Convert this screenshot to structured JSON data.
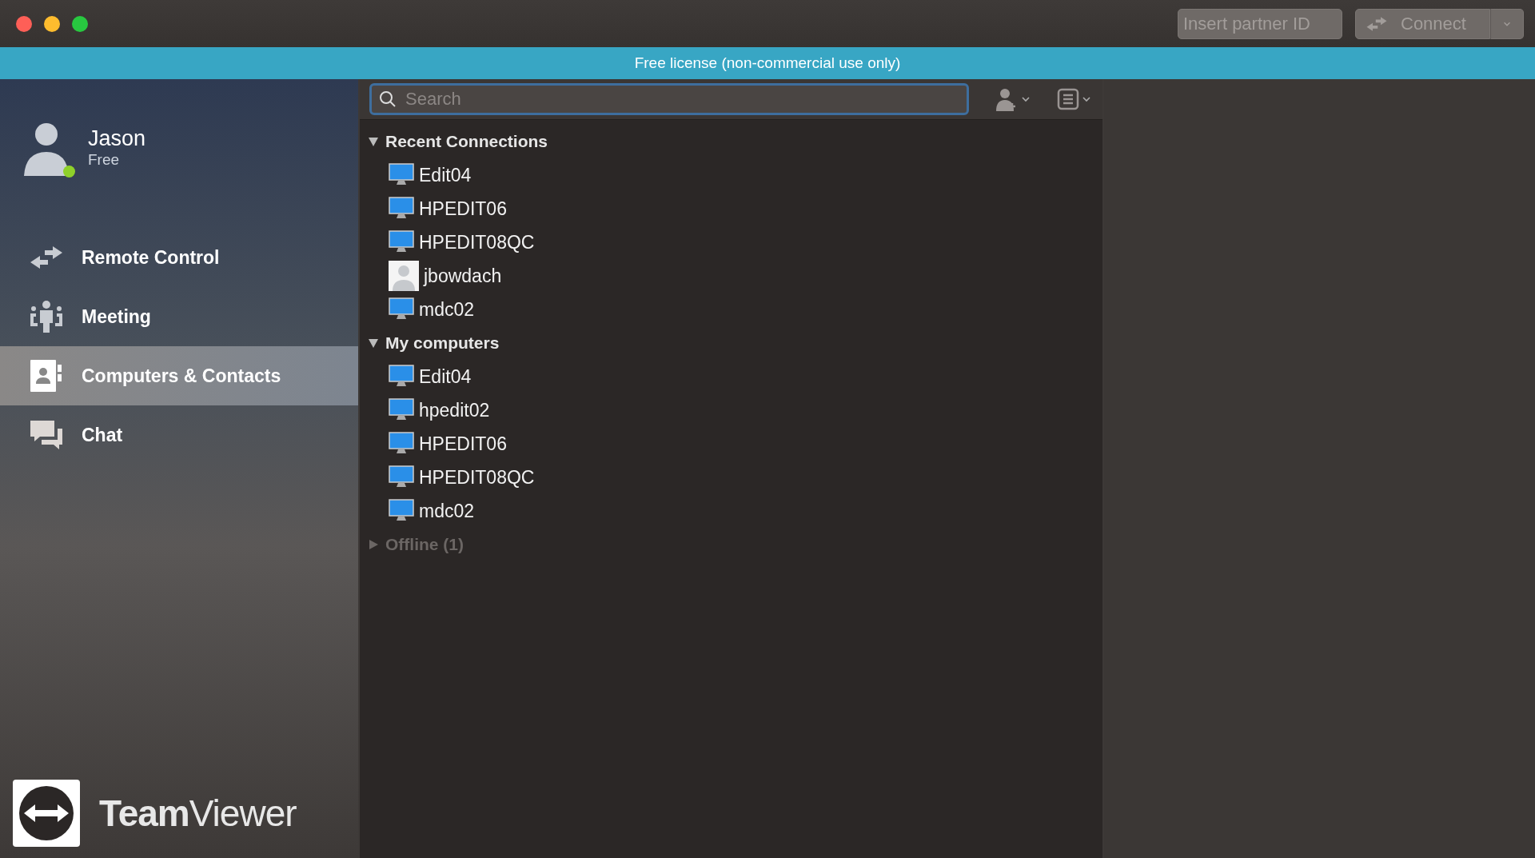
{
  "titlebar": {
    "partner_id": {
      "placeholder": "Insert partner ID"
    },
    "connect_button": "Connect"
  },
  "banner": "Free license (non-commercial use only)",
  "profile": {
    "name": "Jason",
    "plan": "Free",
    "online": true
  },
  "nav": [
    {
      "kind": "remote",
      "label": "Remote Control",
      "selected": false
    },
    {
      "kind": "meeting",
      "label": "Meeting",
      "selected": false
    },
    {
      "kind": "contacts",
      "label": "Computers & Contacts",
      "selected": true
    },
    {
      "kind": "chat",
      "label": "Chat",
      "selected": false
    }
  ],
  "logo": "**Team**Viewer",
  "search": {
    "placeholder": "Search"
  },
  "groups": [
    {
      "label": "Recent Connections",
      "expanded": true,
      "disabled": false,
      "children": [
        {
          "kind": "computer",
          "label": "Edit04"
        },
        {
          "kind": "computer",
          "label": "HPEDIT06"
        },
        {
          "kind": "computer",
          "label": "HPEDIT08QC"
        },
        {
          "kind": "contact",
          "label": "jbowdach"
        },
        {
          "kind": "computer",
          "label": "mdc02"
        }
      ]
    },
    {
      "label": "My computers",
      "expanded": true,
      "disabled": false,
      "children": [
        {
          "kind": "computer",
          "label": "Edit04"
        },
        {
          "kind": "computer",
          "label": "hpedit02"
        },
        {
          "kind": "computer",
          "label": "HPEDIT06"
        },
        {
          "kind": "computer",
          "label": "HPEDIT08QC"
        },
        {
          "kind": "computer",
          "label": "mdc02"
        }
      ]
    },
    {
      "label": "Offline (1)",
      "expanded": false,
      "disabled": true
    }
  ]
}
